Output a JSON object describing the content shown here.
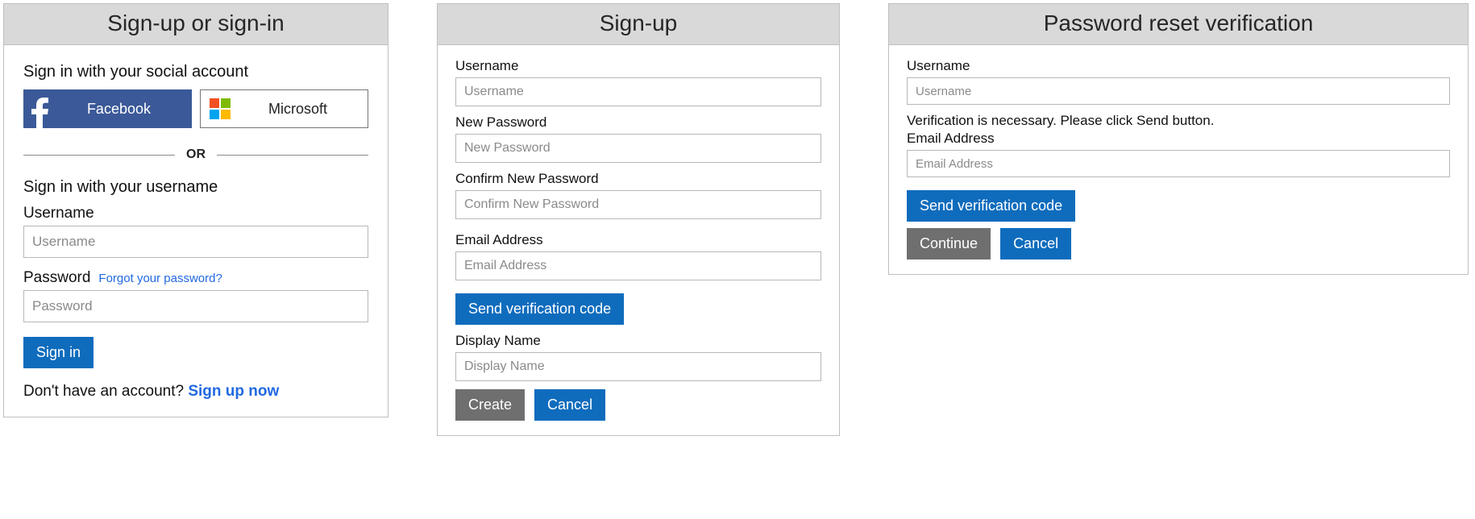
{
  "signin": {
    "title": "Sign-up or sign-in",
    "socialHeading": "Sign in with your social account",
    "facebook": "Facebook",
    "microsoft": "Microsoft",
    "or": "OR",
    "localHeading": "Sign in with your username",
    "usernameLabel": "Username",
    "usernamePh": "Username",
    "passwordLabel": "Password",
    "passwordPh": "Password",
    "forgot": "Forgot your password?",
    "signinBtn": "Sign in",
    "noAccount": "Don't have an account? ",
    "signupNow": "Sign up now"
  },
  "signup": {
    "title": "Sign-up",
    "usernameLabel": "Username",
    "usernamePh": "Username",
    "newPwLabel": "New Password",
    "newPwPh": "New Password",
    "confirmPwLabel": "Confirm New Password",
    "confirmPwPh": "Confirm New Password",
    "emailLabel": "Email Address",
    "emailPh": "Email Address",
    "sendCode": "Send verification code",
    "displayLabel": "Display Name",
    "displayPh": "Display Name",
    "createBtn": "Create",
    "cancelBtn": "Cancel"
  },
  "reset": {
    "title": "Password reset verification",
    "usernameLabel": "Username",
    "usernamePh": "Username",
    "verifyMsg": "Verification is necessary. Please click Send button.",
    "emailLabel": "Email Address",
    "emailPh": "Email Address",
    "sendCode": "Send verification code",
    "continueBtn": "Continue",
    "cancelBtn": "Cancel"
  }
}
